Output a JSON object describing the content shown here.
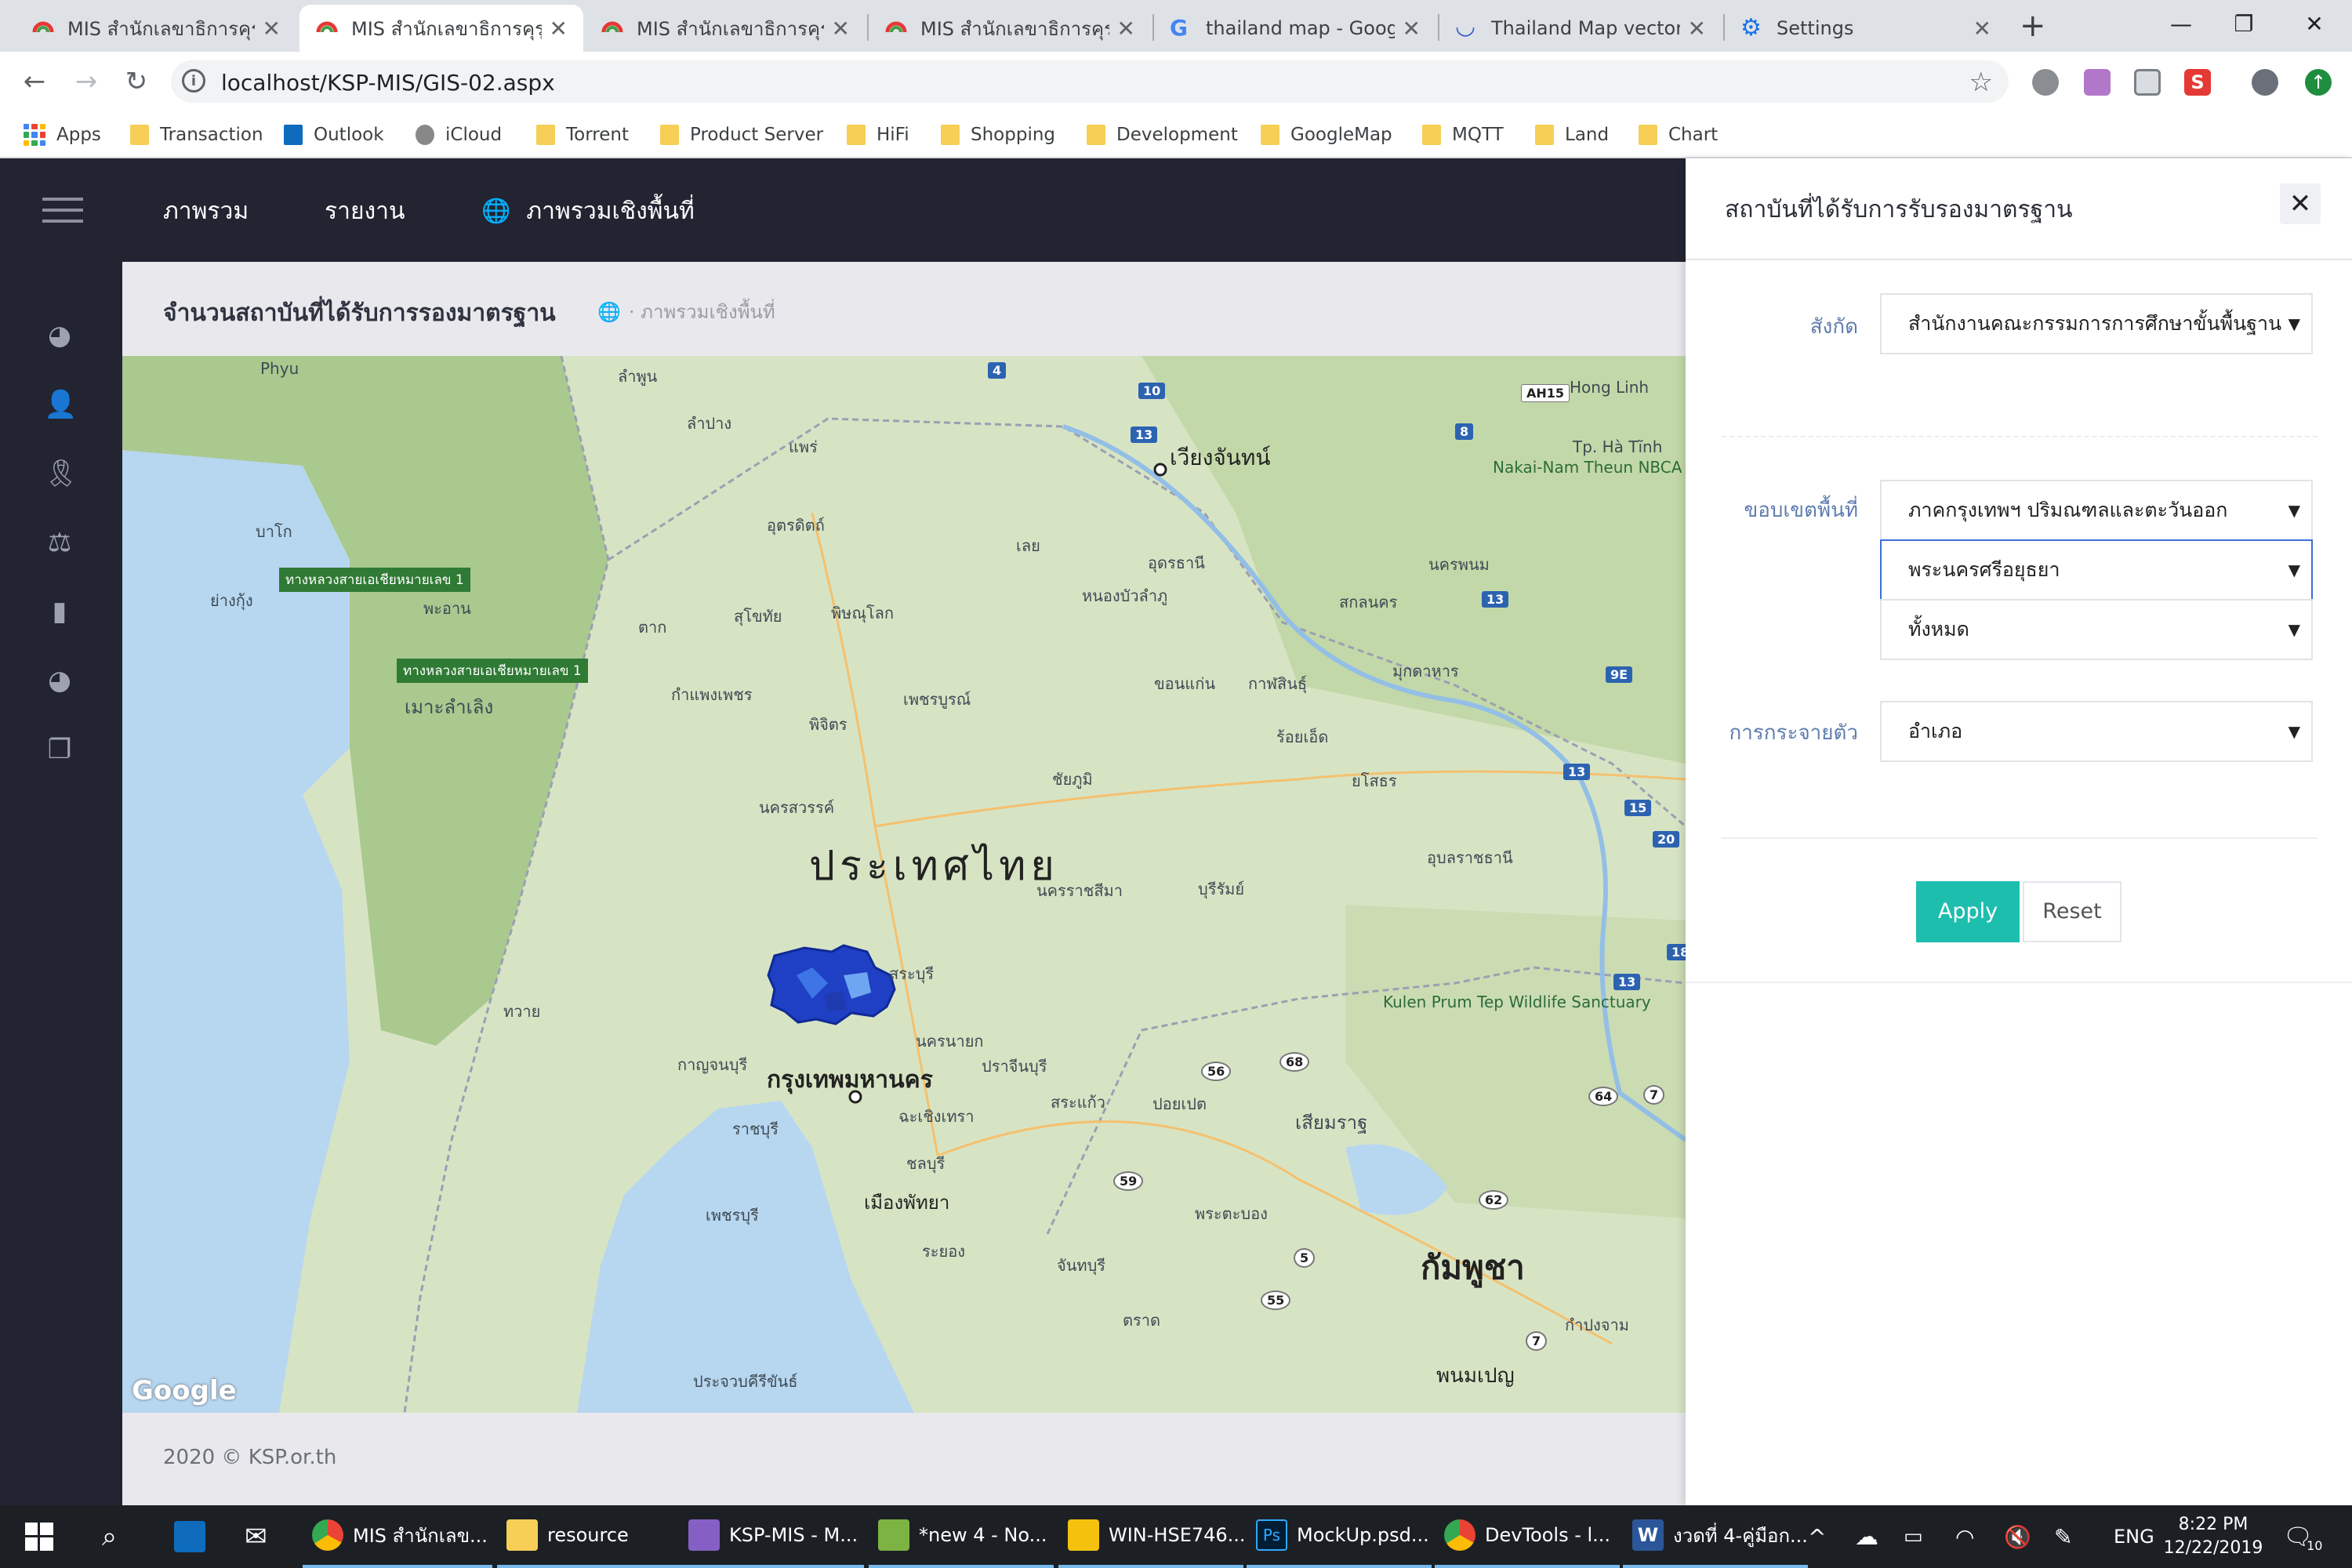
{
  "browser": {
    "tabs": [
      {
        "label": "MIS สำนักเลขาธิการคุรุส",
        "active": false,
        "icon": "mis-favicon-icon"
      },
      {
        "label": "MIS สำนักเลขาธิการคุรุส",
        "active": true,
        "icon": "mis-favicon-icon"
      },
      {
        "label": "MIS สำนักเลขาธิการคุรุส",
        "active": false,
        "icon": "mis-favicon-icon"
      },
      {
        "label": "MIS สำนักเลขาธิการคุรุส",
        "active": false,
        "icon": "mis-favicon-icon"
      },
      {
        "label": "thailand map - Googl",
        "active": false,
        "icon": "google-icon"
      },
      {
        "label": "Thailand Map vector f",
        "active": false,
        "icon": "wave-icon"
      },
      {
        "label": "Settings",
        "active": false,
        "icon": "gear-icon"
      }
    ],
    "url": "localhost/KSP-MIS/GIS-02.aspx",
    "bookmarks": [
      "Apps",
      "Transaction",
      "Outlook",
      "iCloud",
      "Torrent",
      "Product Server",
      "HiFi",
      "Shopping",
      "Development",
      "GoogleMap",
      "MQTT",
      "Land",
      "Chart"
    ]
  },
  "app": {
    "nav": {
      "items": [
        "ภาพรวม",
        "รายงาน",
        "ภาพรวมเชิงพื้นที่"
      ]
    },
    "page": {
      "title": "จำนวนสถาบันที่ได้รับการรองมาตรฐาน",
      "breadcrumb": "ภาพรวมเชิงพื้นที่"
    },
    "map": {
      "country_label": "ประเทศไทย",
      "capital_label": "กรุงเทพมหานคร",
      "cambodia_label": "กัมพูชา",
      "vientiane_label": "เวียงจันทน์",
      "attribution": "Google",
      "labels": [
        "ลำพูน",
        "ลำปาง",
        "แพร่",
        "อุตรดิตถ์",
        "เลย",
        "อุดรธานี",
        "หนองบัวลำภู",
        "สกลนคร",
        "นครพนม",
        "สุโขทัย",
        "พิษณุโลก",
        "เพชรบูรณ์",
        "ขอนแก่น",
        "กาฬสินธุ์",
        "ร้อยเอ็ด",
        "มุกดาหาร",
        "ยโสธร",
        "ชัยภูมิ",
        "นครสวรรค์",
        "พิจิตร",
        "กำแพงเพชร",
        "ตาก",
        "นครราชสีมา",
        "บุรีรัมย์",
        "อุบลราชธานี",
        "สระบุรี",
        "นครนายก",
        "ปราจีนบุรี",
        "สระแก้ว",
        "กาญจนบุรี",
        "ราชบุรี",
        "ฉะเชิงเทรา",
        "ชลบุรี",
        "เมืองพัทยา",
        "ระยอง",
        "จันทบุรี",
        "ตราด",
        "เพชรบุรี",
        "ประจวบคีรีขันธ์",
        "ทวาย",
        "บาโก",
        "ย่างกุ้ง",
        "พะอาน",
        "เมาะลำเลิง",
        "Phyu",
        "Nakai-Nam Theun NBCA",
        "Hong Linh",
        "Tp. Hà Tĩnh",
        "Kulen Prum Tep Wildlife Sanctuary",
        "ปอยเปต",
        "เสียมราฐ",
        "พระตะบอง",
        "กำปงจาม",
        "พนมเปญ"
      ],
      "road_signs": [
        "4",
        "10",
        "13",
        "8",
        "AH15",
        "13",
        "9E",
        "13",
        "15",
        "20",
        "18",
        "13",
        "56",
        "68",
        "64",
        "7",
        "59",
        "62",
        "5",
        "55",
        "7"
      ],
      "highway_signs": [
        "ทางหลวงสายเอเชียหมายเลข 1",
        "ทางหลวงสายเอเชียหมายเลข 1"
      ]
    },
    "footer": "2020 © KSP.or.th",
    "panel": {
      "title": "สถาบันที่ได้รับการรับรองมาตรฐาน",
      "affiliation_label": "สังกัด",
      "affiliation_value": "สำนักงานคณะกรรมการการศึกษาขั้นพื้นฐาน",
      "area_label": "ขอบเขตพื้นที่",
      "region_value": "ภาคกรุงเทพฯ ปริมณฑลและตะวันออก",
      "province_value": "พระนครศรีอยุธยา",
      "district_value": "ทั้งหมด",
      "distribution_label": "การกระจายตัว",
      "distribution_value": "อำเภอ",
      "apply_label": "Apply",
      "reset_label": "Reset"
    }
  },
  "taskbar": {
    "items": [
      {
        "label": "MIS สำนักเลข...",
        "icon": "chrome-icon"
      },
      {
        "label": "resource",
        "icon": "folder-icon"
      },
      {
        "label": "KSP-MIS - M...",
        "icon": "visual-studio-icon"
      },
      {
        "label": "*new 4 - No...",
        "icon": "notepad-icon"
      },
      {
        "label": "WIN-HSE746...",
        "icon": "remote-desktop-icon"
      },
      {
        "label": "MockUp.psd...",
        "icon": "photoshop-icon"
      },
      {
        "label": "DevTools - l...",
        "icon": "chrome-icon"
      },
      {
        "label": "งวดที่ 4-คู่มือก...",
        "icon": "word-icon"
      }
    ],
    "language": "ENG",
    "time": "8:22 PM",
    "date": "12/22/2019",
    "notifications": "10"
  },
  "colors": {
    "nav_bg": "#222431",
    "accent": "#1ebeae",
    "overlay_blue": "#1f3fc4"
  }
}
